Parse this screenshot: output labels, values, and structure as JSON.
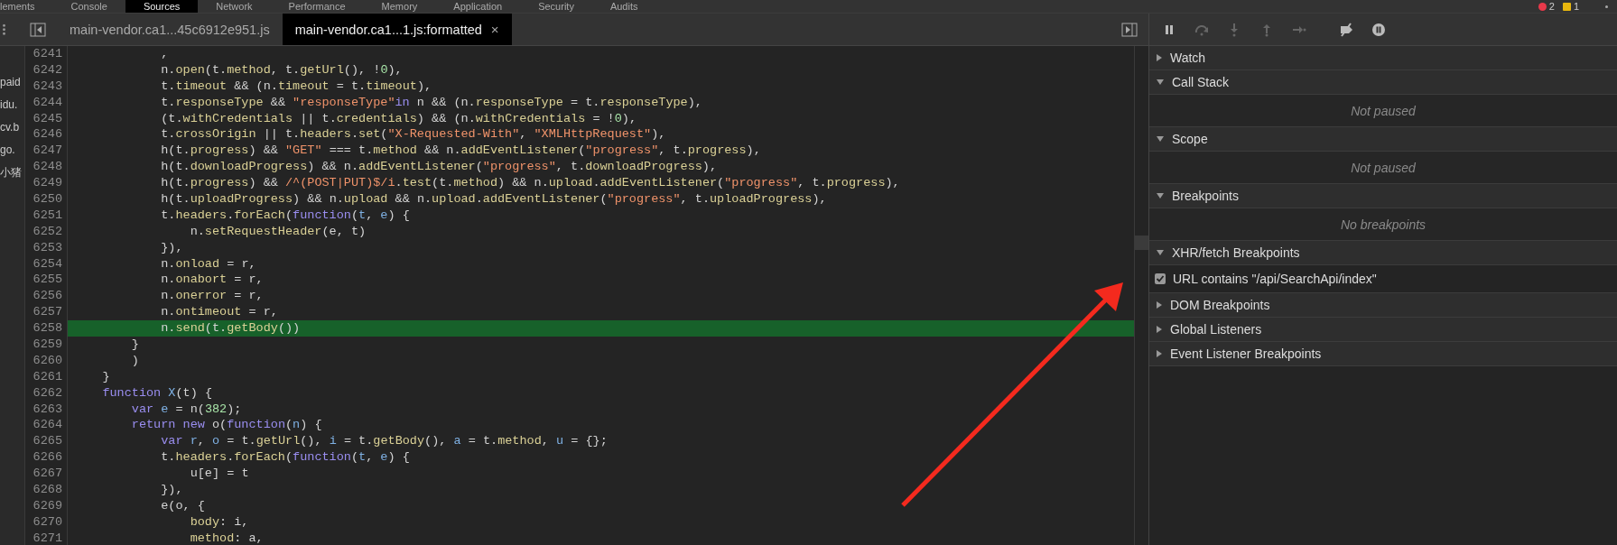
{
  "panel_tabs": [
    {
      "label": "lements",
      "selected": false
    },
    {
      "label": "Console",
      "selected": false
    },
    {
      "label": "Sources",
      "selected": true
    },
    {
      "label": "Network",
      "selected": false
    },
    {
      "label": "Performance",
      "selected": false
    },
    {
      "label": "Memory",
      "selected": false
    },
    {
      "label": "Application",
      "selected": false
    },
    {
      "label": "Security",
      "selected": false
    },
    {
      "label": "Audits",
      "selected": false
    }
  ],
  "status": {
    "errors": "2",
    "warnings": "1"
  },
  "file_tabs": [
    {
      "label": "main-vendor.ca1...45c6912e951.js",
      "selected": false
    },
    {
      "label": "main-vendor.ca1...1.js:formatted",
      "selected": true,
      "close": "×"
    }
  ],
  "navigator_items": [
    "paid",
    "idu.",
    "cv.b",
    "go.",
    "小猪"
  ],
  "code_lines": [
    {
      "number": "6241",
      "highlighted": false,
      "text": "            ,"
    },
    {
      "number": "6242",
      "highlighted": false,
      "text": "            n.open(t.method, t.getUrl(), !0),"
    },
    {
      "number": "6243",
      "highlighted": false,
      "text": "            t.timeout && (n.timeout = t.timeout),"
    },
    {
      "number": "6244",
      "highlighted": false,
      "text": "            t.responseType && \"responseType\"in n && (n.responseType = t.responseType),"
    },
    {
      "number": "6245",
      "highlighted": false,
      "text": "            (t.withCredentials || t.credentials) && (n.withCredentials = !0),"
    },
    {
      "number": "6246",
      "highlighted": false,
      "text": "            t.crossOrigin || t.headers.set(\"X-Requested-With\", \"XMLHttpRequest\"),"
    },
    {
      "number": "6247",
      "highlighted": false,
      "text": "            h(t.progress) && \"GET\" === t.method && n.addEventListener(\"progress\", t.progress),"
    },
    {
      "number": "6248",
      "highlighted": false,
      "text": "            h(t.downloadProgress) && n.addEventListener(\"progress\", t.downloadProgress),"
    },
    {
      "number": "6249",
      "highlighted": false,
      "text": "            h(t.progress) && /^(POST|PUT)$/i.test(t.method) && n.upload.addEventListener(\"progress\", t.progress),"
    },
    {
      "number": "6250",
      "highlighted": false,
      "text": "            h(t.uploadProgress) && n.upload && n.upload.addEventListener(\"progress\", t.uploadProgress),"
    },
    {
      "number": "6251",
      "highlighted": false,
      "text": "            t.headers.forEach(function(t, e) {"
    },
    {
      "number": "6252",
      "highlighted": false,
      "text": "                n.setRequestHeader(e, t)"
    },
    {
      "number": "6253",
      "highlighted": false,
      "text": "            }),"
    },
    {
      "number": "6254",
      "highlighted": false,
      "text": "            n.onload = r,"
    },
    {
      "number": "6255",
      "highlighted": false,
      "text": "            n.onabort = r,"
    },
    {
      "number": "6256",
      "highlighted": false,
      "text": "            n.onerror = r,"
    },
    {
      "number": "6257",
      "highlighted": false,
      "text": "            n.ontimeout = r,"
    },
    {
      "number": "6258",
      "highlighted": true,
      "text": "            n.send(t.getBody())"
    },
    {
      "number": "6259",
      "highlighted": false,
      "text": "        }"
    },
    {
      "number": "6260",
      "highlighted": false,
      "text": "        )"
    },
    {
      "number": "6261",
      "highlighted": false,
      "text": "    }"
    },
    {
      "number": "6262",
      "highlighted": false,
      "text": "    function X(t) {"
    },
    {
      "number": "6263",
      "highlighted": false,
      "text": "        var e = n(382);"
    },
    {
      "number": "6264",
      "highlighted": false,
      "text": "        return new o(function(n) {"
    },
    {
      "number": "6265",
      "highlighted": false,
      "text": "            var r, o = t.getUrl(), i = t.getBody(), a = t.method, u = {};"
    },
    {
      "number": "6266",
      "highlighted": false,
      "text": "            t.headers.forEach(function(t, e) {"
    },
    {
      "number": "6267",
      "highlighted": false,
      "text": "                u[e] = t"
    },
    {
      "number": "6268",
      "highlighted": false,
      "text": "            }),"
    },
    {
      "number": "6269",
      "highlighted": false,
      "text": "            e(o, {"
    },
    {
      "number": "6270",
      "highlighted": false,
      "text": "                body: i,"
    },
    {
      "number": "6271",
      "highlighted": false,
      "text": "                method: a,"
    }
  ],
  "debugger_toolbar": [
    {
      "kind": "pause",
      "disabled": false
    },
    {
      "kind": "step-over",
      "disabled": true
    },
    {
      "kind": "step-into",
      "disabled": true
    },
    {
      "kind": "step-out",
      "disabled": true
    },
    {
      "kind": "step",
      "disabled": true
    },
    {
      "kind": "deactivate",
      "disabled": false
    },
    {
      "kind": "pause-exceptions",
      "disabled": false
    }
  ],
  "sections": [
    {
      "title": "Watch",
      "expanded": false
    },
    {
      "title": "Call Stack",
      "expanded": true,
      "empty_text": "Not paused"
    },
    {
      "title": "Scope",
      "expanded": true,
      "empty_text": "Not paused"
    },
    {
      "title": "Breakpoints",
      "expanded": true,
      "empty_text": "No breakpoints"
    },
    {
      "title": "XHR/fetch Breakpoints",
      "expanded": true,
      "items": [
        {
          "label": "URL contains \"/api/SearchApi/index\"",
          "checked": true
        }
      ]
    },
    {
      "title": "DOM Breakpoints",
      "expanded": false
    },
    {
      "title": "Global Listeners",
      "expanded": false
    },
    {
      "title": "Event Listener Breakpoints",
      "expanded": false
    }
  ]
}
